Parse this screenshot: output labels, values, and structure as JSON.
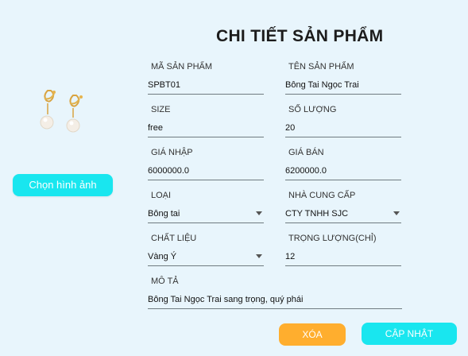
{
  "header": {
    "title": "CHI TIẾT SẢN PHẨM"
  },
  "image_panel": {
    "choose_label": "Chọn hình ảnh"
  },
  "fields": {
    "code": {
      "label": "MÃ SẢN PHẨM",
      "value": "SPBT01"
    },
    "name": {
      "label": "TÊN SẢN PHẨM",
      "value": "Bông Tai Ngọc Trai"
    },
    "size": {
      "label": "SIZE",
      "value": "free"
    },
    "quantity": {
      "label": "SỐ LƯỢNG",
      "value": "20"
    },
    "cost": {
      "label": "GIÁ NHẬP",
      "value": "6000000.0"
    },
    "price": {
      "label": "GIÁ BÁN",
      "value": "6200000.0"
    },
    "type": {
      "label": "LOẠI",
      "value": "Bông tai"
    },
    "supplier": {
      "label": "NHÀ CUNG CẤP",
      "value": "CTY TNHH SJC"
    },
    "material": {
      "label": "CHẤT LIỆU",
      "value": "Vàng Ý"
    },
    "weight": {
      "label": "TRỌNG LƯỢNG(CHỈ)",
      "value": "12"
    },
    "description": {
      "label": "MÔ TẢ",
      "value": "Bông Tai Ngọc Trai sang trọng, quý phái"
    }
  },
  "actions": {
    "delete_label": "XÓA",
    "update_label": "CẬP NHẬT"
  },
  "colors": {
    "background": "#e8f5fc",
    "primary": "#19e6ef",
    "warning": "#ffae2e"
  }
}
